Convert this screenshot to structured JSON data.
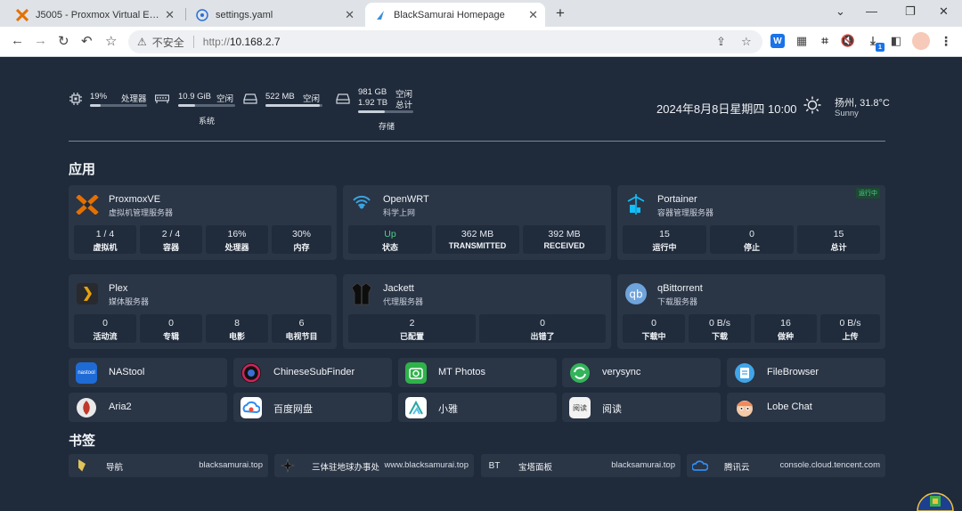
{
  "browser": {
    "tabs": [
      {
        "title": "J5005 - Proxmox Virtual Environment"
      },
      {
        "title": "settings.yaml"
      },
      {
        "title": "BlackSamurai Homepage"
      }
    ],
    "new_tab_label": "+",
    "address": {
      "security_label": "不安全",
      "protocol": "http://",
      "host": "10.168.2.7"
    },
    "download_badge": "1"
  },
  "resources": {
    "cpu": {
      "value": "19%",
      "label": "处理器",
      "fill": 0.19
    },
    "ram": {
      "value": "10.9 GiB",
      "label": "空闲",
      "fill": 0.3
    },
    "swap": {
      "value": "522 MB",
      "label": "空闲",
      "fill": 0.95
    },
    "system_label": "系统",
    "disk": {
      "free_value": "981 GB",
      "free_label": "空闲",
      "total_value": "1.92 TB",
      "total_label": "总计",
      "fill": 0.49
    },
    "storage_label": "存储"
  },
  "datetime": "2024年8月8日星期四 10:00",
  "weather": {
    "city_temp": "扬州, 31.8°C",
    "condition": "Sunny"
  },
  "sections": {
    "apps": "应用",
    "bookmarks": "书签"
  },
  "cards": [
    {
      "name": "ProxmoxVE",
      "desc": "虚拟机管理服务器",
      "badge": "",
      "stats": [
        {
          "v": "1 / 4",
          "l": "虚拟机"
        },
        {
          "v": "2 / 4",
          "l": "容器"
        },
        {
          "v": "16%",
          "l": "处理器"
        },
        {
          "v": "30%",
          "l": "内存"
        }
      ]
    },
    {
      "name": "OpenWRT",
      "desc": "科学上网",
      "badge": "",
      "stats": [
        {
          "v": "Up",
          "l": "状态"
        },
        {
          "v": "362 MB",
          "l": "TRANSMITTED"
        },
        {
          "v": "392 MB",
          "l": "RECEIVED"
        }
      ]
    },
    {
      "name": "Portainer",
      "desc": "容器管理服务器",
      "badge": "运行中",
      "stats": [
        {
          "v": "15",
          "l": "运行中"
        },
        {
          "v": "0",
          "l": "停止"
        },
        {
          "v": "15",
          "l": "总计"
        }
      ]
    },
    {
      "name": "Plex",
      "desc": "媒体服务器",
      "badge": "",
      "stats": [
        {
          "v": "0",
          "l": "活动流"
        },
        {
          "v": "0",
          "l": "专辑"
        },
        {
          "v": "8",
          "l": "电影"
        },
        {
          "v": "6",
          "l": "电视节目"
        }
      ]
    },
    {
      "name": "Jackett",
      "desc": "代理服务器",
      "badge": "",
      "stats": [
        {
          "v": "2",
          "l": "已配置"
        },
        {
          "v": "0",
          "l": "出错了"
        }
      ]
    },
    {
      "name": "qBittorrent",
      "desc": "下载服务器",
      "badge": "",
      "stats": [
        {
          "v": "0",
          "l": "下载中"
        },
        {
          "v": "0 B/s",
          "l": "下载"
        },
        {
          "v": "16",
          "l": "做种"
        },
        {
          "v": "0 B/s",
          "l": "上传"
        }
      ]
    }
  ],
  "apps": [
    {
      "name": "NAStool",
      "icon": "nastool-icon",
      "logo_text": "nastool"
    },
    {
      "name": "ChineseSubFinder",
      "icon": "chinesesubfinder-icon"
    },
    {
      "name": "MT Photos",
      "icon": "mt-photos-icon"
    },
    {
      "name": "verysync",
      "icon": "verysync-icon"
    },
    {
      "name": "FileBrowser",
      "icon": "filebrowser-icon"
    },
    {
      "name": "Aria2",
      "icon": "aria2-icon"
    },
    {
      "name": "百度网盘",
      "icon": "baidu-netdisk-icon"
    },
    {
      "name": "小雅",
      "icon": "xiaoya-icon"
    },
    {
      "name": "阅读",
      "icon": "reader-icon",
      "logo_text": "阅读"
    },
    {
      "name": "Lobe Chat",
      "icon": "lobe-chat-icon"
    }
  ],
  "bookmarks": [
    {
      "name": "导航",
      "url": "blacksamurai.top",
      "icon": "samurai-icon"
    },
    {
      "name": "三体驻地球办事处",
      "url": "www.blacksamurai.top",
      "icon": "star-icon"
    },
    {
      "name": "宝塔面板",
      "url": "blacksamurai.top",
      "icon": "bt-icon",
      "abbr": "BT"
    },
    {
      "name": "腾讯云",
      "url": "console.cloud.tencent.com",
      "icon": "tencent-cloud-icon"
    }
  ],
  "colors": {
    "bg": "#1f2a3a",
    "card": "#2a3546",
    "stat": "#202b3b",
    "up": "#4fd08a"
  }
}
